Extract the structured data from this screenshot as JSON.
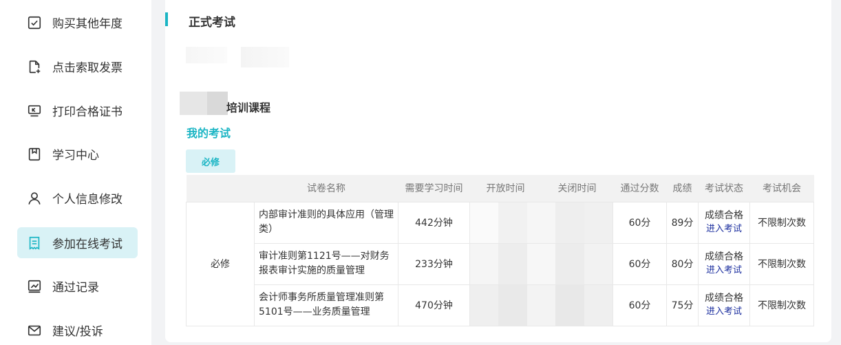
{
  "sidebar": {
    "items": [
      {
        "label": "购买其他年度",
        "icon": "checkbox-icon",
        "active": false
      },
      {
        "label": "点击索取发票",
        "icon": "file-add-icon",
        "active": false
      },
      {
        "label": "打印合格证书",
        "icon": "monitor-icon",
        "active": false
      },
      {
        "label": "学习中心",
        "icon": "book-icon",
        "active": false
      },
      {
        "label": "个人信息修改",
        "icon": "user-icon",
        "active": false
      },
      {
        "label": "参加在线考试",
        "icon": "exam-icon",
        "active": true
      },
      {
        "label": "通过记录",
        "icon": "chart-icon",
        "active": false
      },
      {
        "label": "建议/投诉",
        "icon": "mail-icon",
        "active": false
      }
    ]
  },
  "main": {
    "section_title": "正式考试",
    "course_title": "培训课程",
    "my_exam_label": "我的考试",
    "tag_label": "必修",
    "table": {
      "headers": [
        "",
        "试卷名称",
        "需要学习时间",
        "开放时间",
        "关闭时间",
        "通过分数",
        "成绩",
        "考试状态",
        "考试机会"
      ],
      "category": "必修",
      "rows": [
        {
          "paper": "内部审计准则的具体应用（管理类）",
          "study_time": "442分钟",
          "pass_score": "60分",
          "score": "89分",
          "status": "成绩合格",
          "action": "进入考试",
          "chances": "不限制次数"
        },
        {
          "paper": "审计准则第1121号——对财务报表审计实施的质量管理",
          "study_time": "233分钟",
          "pass_score": "60分",
          "score": "80分",
          "status": "成绩合格",
          "action": "进入考试",
          "chances": "不限制次数"
        },
        {
          "paper": "会计师事务所质量管理准则第5101号——业务质量管理",
          "study_time": "470分钟",
          "pass_score": "60分",
          "score": "75分",
          "status": "成绩合格",
          "action": "进入考试",
          "chances": "不限制次数"
        }
      ]
    }
  },
  "colors": {
    "accent": "#1bb5c4",
    "active_bg": "#d9f2f6",
    "link": "#1a2d9e"
  }
}
